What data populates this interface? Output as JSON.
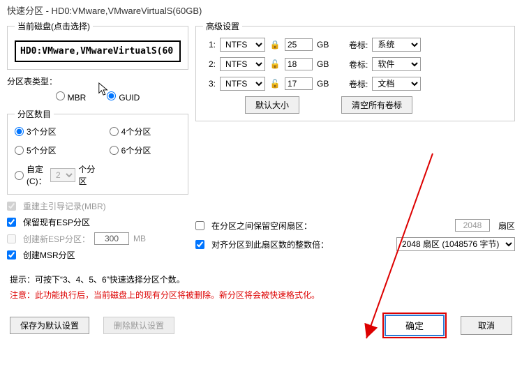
{
  "title": "快速分区 - HD0:VMware,VMwareVirtualS(60GB)",
  "currentDisk": {
    "legend": "当前磁盘(点击选择)",
    "value": "HD0:VMware,VMwareVirtualS(60"
  },
  "partitionTable": {
    "label": "分区表类型：",
    "mbr": "MBR",
    "guid": "GUID"
  },
  "partitionCount": {
    "legend": "分区数目",
    "p3": "3个分区",
    "p4": "4个分区",
    "p5": "5个分区",
    "p6": "6个分区",
    "customLabel": "自定(C)：",
    "customValue": "2",
    "customUnit": "个分区"
  },
  "mbrRebuild": "重建主引导记录(MBR)",
  "keepEsp": "保留现有ESP分区",
  "newEsp": {
    "label": "创建新ESP分区：",
    "value": "300",
    "unit": "MB"
  },
  "createMsr": "创建MSR分区",
  "advanced": {
    "legend": "高级设置",
    "rows": [
      {
        "idx": "1:",
        "fs": "NTFS",
        "size": "25",
        "unit": "GB",
        "volLabel": "卷标:",
        "vol": "系统"
      },
      {
        "idx": "2:",
        "fs": "NTFS",
        "size": "18",
        "unit": "GB",
        "volLabel": "卷标:",
        "vol": "软件"
      },
      {
        "idx": "3:",
        "fs": "NTFS",
        "size": "17",
        "unit": "GB",
        "volLabel": "卷标:",
        "vol": "文档"
      }
    ],
    "defaultSize": "默认大小",
    "clearLabels": "清空所有卷标"
  },
  "gapSectors": {
    "label": "在分区之间保留空闲扇区：",
    "value": "2048",
    "unit": "扇区"
  },
  "alignSectors": {
    "label": "对齐分区到此扇区数的整数倍：",
    "value": "2048 扇区 (1048576 字节)"
  },
  "tips": {
    "line1a": "提示：可按下",
    "line1b": "“3、4、5、6”",
    "line1c": "快速选择分区个数。",
    "line2a": "注意：此功能执行后，当前磁盘上的现有分区将被删除。新分区将会被快速格式化。"
  },
  "buttons": {
    "saveDefault": "保存为默认设置",
    "deleteDefault": "删除默认设置",
    "ok": "确定",
    "cancel": "取消"
  }
}
